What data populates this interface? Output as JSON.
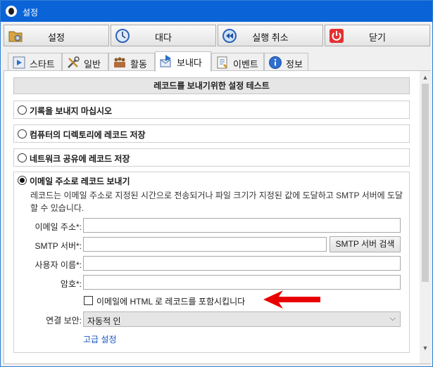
{
  "window": {
    "title": "설정"
  },
  "toolbar": {
    "buttons": [
      {
        "label": "설정",
        "icon": "settings-folder-icon"
      },
      {
        "label": "대다",
        "icon": "clock-icon"
      },
      {
        "label": "실행 취소",
        "icon": "undo-icon"
      },
      {
        "label": "닫기",
        "icon": "power-icon"
      }
    ]
  },
  "tabs": [
    {
      "label": "스타트",
      "icon": "play-icon"
    },
    {
      "label": "일반",
      "icon": "tools-icon"
    },
    {
      "label": "활동",
      "icon": "activity-icon"
    },
    {
      "label": "보내다",
      "icon": "send-icon",
      "active": true
    },
    {
      "label": "이벤트",
      "icon": "event-icon"
    },
    {
      "label": "정보",
      "icon": "info-icon"
    }
  ],
  "panel": {
    "header": "레코드를 보내기위한 설정 테스트",
    "options": [
      {
        "label": "기록을 보내지 마십시오",
        "checked": false
      },
      {
        "label": "컴퓨터의 디렉토리에 레코드 저장",
        "checked": false
      },
      {
        "label": "네트워크 공유에 레코드 저장",
        "checked": false
      },
      {
        "label": "이메일 주소로 레코드 보내기",
        "checked": true
      }
    ],
    "email": {
      "description": "레코드는 이메일 주소로 지정된 시간으로 전송되거나 파일 크기가 지정된 값에 도달하고 SMTP 서버에 도달 할 수 있습니다.",
      "fields": {
        "address_label": "이메일 주소*:",
        "address_value": "",
        "smtp_label": "SMTP 서버*:",
        "smtp_value": "",
        "smtp_search_button": "SMTP 서버 검색",
        "user_label": "사용자 이름*:",
        "user_value": "",
        "password_label": "암호*:",
        "password_value": ""
      },
      "html_checkbox": {
        "label": "이메일에 HTML 로 레코드를 포함시킵니다",
        "checked": false
      },
      "security": {
        "label": "연결 보안:",
        "value": "자동적 인"
      },
      "advanced_link": "고급 설정"
    }
  },
  "colors": {
    "titlebar": "#0a64d8",
    "link": "#1a55c2",
    "arrow": "#e80000"
  }
}
